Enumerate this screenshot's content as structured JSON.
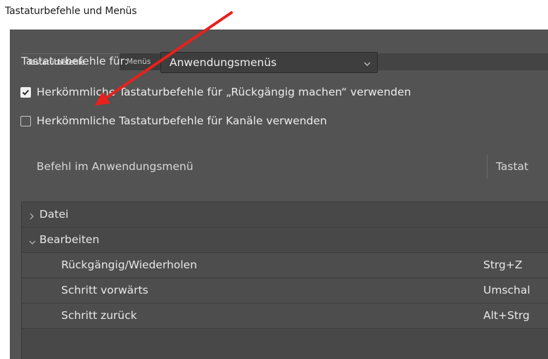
{
  "caption": "Tastaturbefehle und Menüs",
  "tabs": [
    {
      "label": "Tastaturbefehle",
      "active": true
    },
    {
      "label": "Menüs",
      "active": false
    }
  ],
  "shortcuts_for": {
    "label": "Tastaturbefehle für:",
    "selected": "Anwendungsmenüs"
  },
  "options": [
    {
      "label": "Herkömmliche Tastaturbefehle für „Rückgängig machen“ verwenden",
      "checked": true
    },
    {
      "label": "Herkömmliche Tastaturbefehle für Kanäle verwenden",
      "checked": false
    }
  ],
  "table": {
    "col_command": "Befehl im Anwendungsmenü",
    "col_shortcut": "Tastat"
  },
  "tree": [
    {
      "type": "group",
      "label": "Datei",
      "expanded": false
    },
    {
      "type": "group",
      "label": "Bearbeiten",
      "expanded": true
    },
    {
      "type": "command",
      "label": "Rückgängig/Wiederholen",
      "shortcut": "Strg+Z"
    },
    {
      "type": "command",
      "label": "Schritt vorwärts",
      "shortcut": "Umschal"
    },
    {
      "type": "command",
      "label": "Schritt zurück",
      "shortcut": "Alt+Strg"
    }
  ],
  "colors": {
    "panel": "#535353",
    "arrow": "#e8211c"
  }
}
